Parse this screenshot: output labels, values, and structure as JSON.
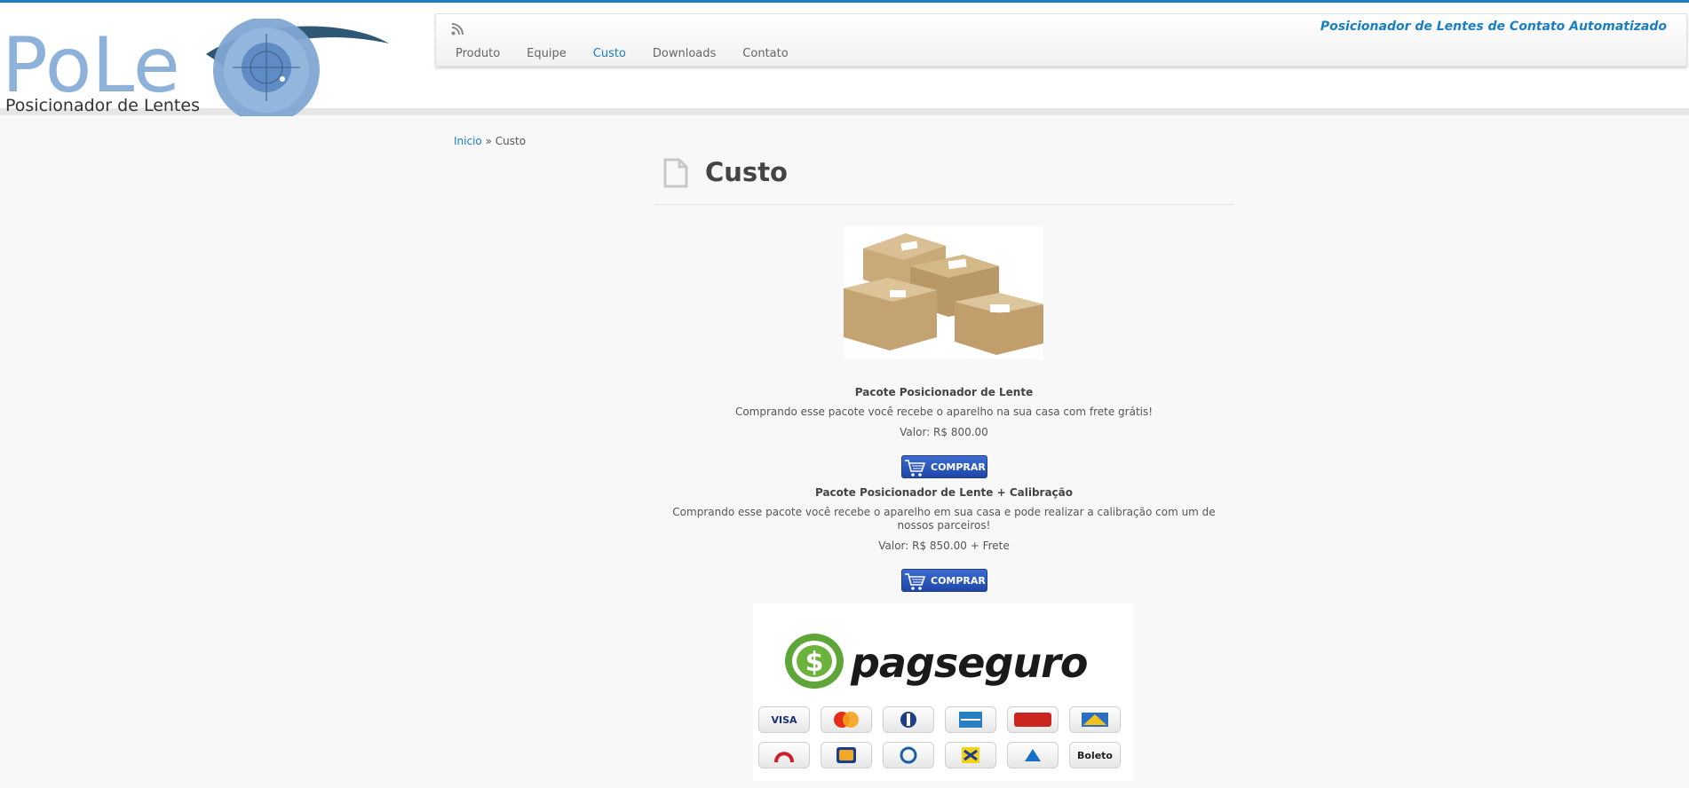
{
  "site": {
    "logo_text": "PoLe",
    "logo_subtitle": "Posicionador de Lentes",
    "tagline": "Posicionador de Lentes de Contato Automatizado"
  },
  "nav": {
    "items": [
      {
        "label": "Produto",
        "active": false
      },
      {
        "label": "Equipe",
        "active": false
      },
      {
        "label": "Custo",
        "active": true
      },
      {
        "label": "Downloads",
        "active": false
      },
      {
        "label": "Contato",
        "active": false
      }
    ]
  },
  "breadcrumb": {
    "home": "Inicio",
    "separator": "»",
    "current": "Custo"
  },
  "page": {
    "title": "Custo"
  },
  "packages": [
    {
      "name": "Pacote Posicionador de Lente",
      "description": "Comprando esse pacote você recebe o aparelho na sua casa com frete grátis!",
      "price": "Valor: R$ 800.00",
      "button": "COMPRAR"
    },
    {
      "name": "Pacote Posicionador de Lente + Calibração",
      "description": "Comprando esse pacote você recebe o aparelho em sua casa e pode realizar a calibração com um de nossos parceiros!",
      "price": "Valor: R$ 850.00 + Frete",
      "button": "COMPRAR"
    }
  ],
  "payment": {
    "brand": "pagseguro",
    "cards": [
      "VISA",
      "MasterCard",
      "Diners",
      "American Express",
      "Hipercard",
      "Aura",
      "Bradesco",
      "Itaú",
      "Banrisul",
      "Banco do Brasil",
      "Caixa",
      "Boleto"
    ]
  },
  "colors": {
    "accent": "#1a7ec2",
    "button": "#2a55be",
    "pag_green": "#6cb33e"
  }
}
